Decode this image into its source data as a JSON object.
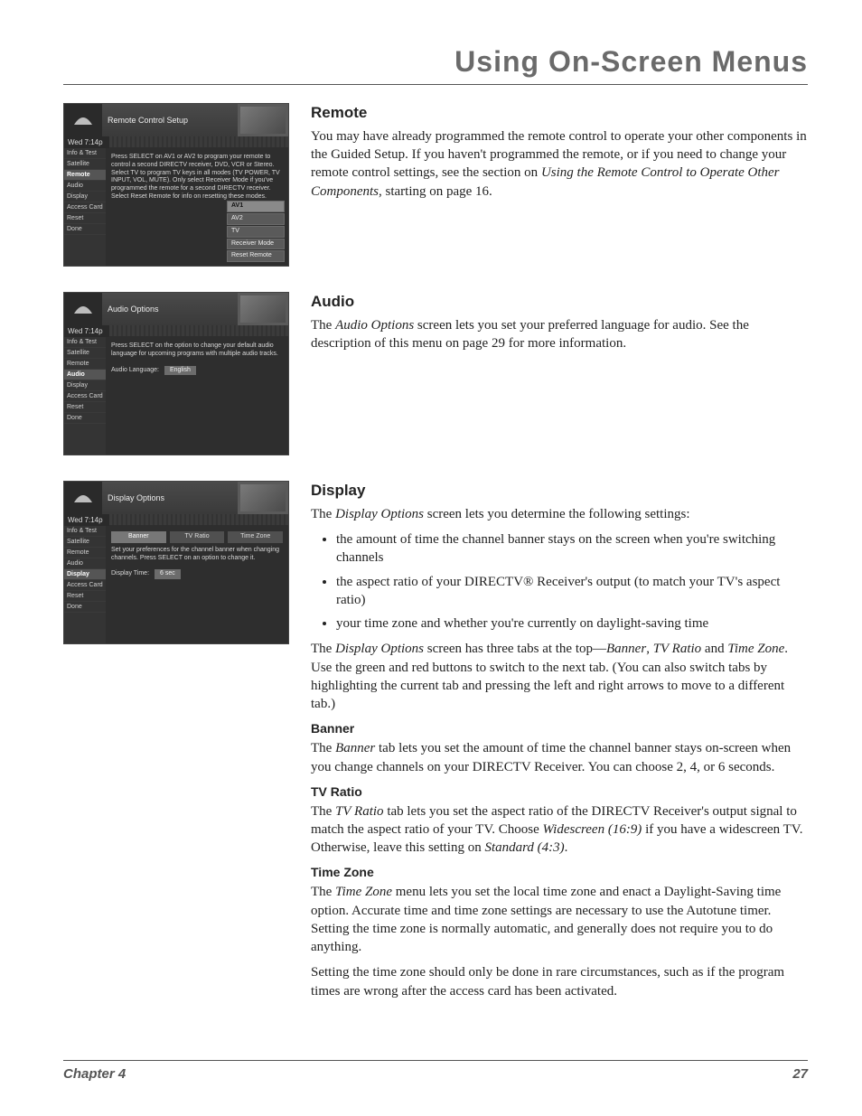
{
  "page_title": "Using On-Screen Menus",
  "footer": {
    "chapter": "Chapter 4",
    "page": "27"
  },
  "sidebar_items": [
    "Info & Test",
    "Satellite",
    "Remote",
    "Audio",
    "Display",
    "Access Card",
    "Reset",
    "Done"
  ],
  "shot_remote": {
    "logo": "DIRECTV",
    "time": "Wed 7:14p",
    "title": "Remote Control Setup",
    "instr": "Press SELECT on AV1 or AV2 to program your remote to control a second DIRECTV receiver, DVD, VCR or Stereo. Select TV to program TV keys in all modes (TV POWER, TV INPUT, VOL, MUTE). Only select Receiver Mode if you've programmed the remote for a second DIRECTV receiver. Select Reset Remote for info on resetting these modes.",
    "menu": [
      "AV1",
      "AV2",
      "TV",
      "Receiver Mode",
      "Reset Remote"
    ],
    "selected_sidebar": "Remote",
    "menu_hi": "AV1"
  },
  "shot_audio": {
    "logo": "DIRECTV",
    "time": "Wed 7:14p",
    "title": "Audio Options",
    "instr": "Press SELECT on the option to change your default audio language for upcoming programs with multiple audio tracks.",
    "label": "Audio Language:",
    "value": "English",
    "selected_sidebar": "Audio"
  },
  "shot_display": {
    "logo": "DIRECTV",
    "time": "Wed 7:14p",
    "title": "Display Options",
    "tabs": [
      "Banner",
      "TV Ratio",
      "Time Zone"
    ],
    "active_tab": "Banner",
    "instr": "Set your preferences for the channel banner when changing channels. Press SELECT on an option to change it.",
    "label": "Display Time:",
    "value": "6 sec",
    "selected_sidebar": "Display"
  },
  "remote": {
    "heading": "Remote",
    "p1a": "You may have already programmed the remote control to operate your other components in the Guided Setup. If you haven't programmed the remote, or if you need to change your remote control settings, see the section on ",
    "p1i": "Using the Remote Control to Operate Other Components",
    "p1b": ", starting on page 16."
  },
  "audio": {
    "heading": "Audio",
    "p1a": "The ",
    "p1i": "Audio Options",
    "p1b": " screen lets you set your preferred language for audio. See the description of this menu on page 29 for more information."
  },
  "display": {
    "heading": "Display",
    "intro_a": "The ",
    "intro_i": "Display Options",
    "intro_b": " screen lets you determine the following settings:",
    "b1": "the amount of time the channel banner stays on the screen when you're switching channels",
    "b2": "the aspect ratio of your DIRECTV® Receiver's output (to match your TV's aspect ratio)",
    "b3": "your time zone and whether you're currently on daylight-saving time",
    "tabs_a": "The ",
    "tabs_i1": "Display Options",
    "tabs_mid1": " screen has three tabs at the top—",
    "tabs_i2": "Banner",
    "tabs_mid2": ", ",
    "tabs_i3": "TV Ratio",
    "tabs_mid3": " and ",
    "tabs_i4": "Time Zone",
    "tabs_b": ". Use the green and red buttons to switch to the next tab. (You can also switch tabs by highlighting the current tab and pressing the left and right arrows to move to a different tab.)",
    "banner_h": "Banner",
    "banner_a": "The ",
    "banner_i": "Banner",
    "banner_b": " tab lets you set the amount of time the channel banner stays on-screen when you change channels on your DIRECTV Receiver. You can choose 2, 4, or 6 seconds.",
    "ratio_h": "TV Ratio",
    "ratio_a": "The ",
    "ratio_i": "TV Ratio",
    "ratio_mid1": " tab lets you set the aspect ratio of the DIRECTV Receiver's output signal to match the aspect ratio of your TV. Choose ",
    "ratio_i2": "Widescreen (16:9)",
    "ratio_mid2": " if you have a widescreen TV. Otherwise, leave this setting on ",
    "ratio_i3": "Standard (4:3)",
    "ratio_b": ".",
    "tz_h": "Time Zone",
    "tz_a": "The ",
    "tz_i": "Time Zone",
    "tz_b": " menu lets you set the local time zone and enact a Daylight-Saving time option. Accurate time and time zone settings are necessary to use the Autotune timer. Setting the time zone is normally automatic, and generally does not require you to do anything.",
    "tz_p2": "Setting the time zone should only be done in rare circumstances, such as if the program times are wrong after the access card has been activated."
  }
}
